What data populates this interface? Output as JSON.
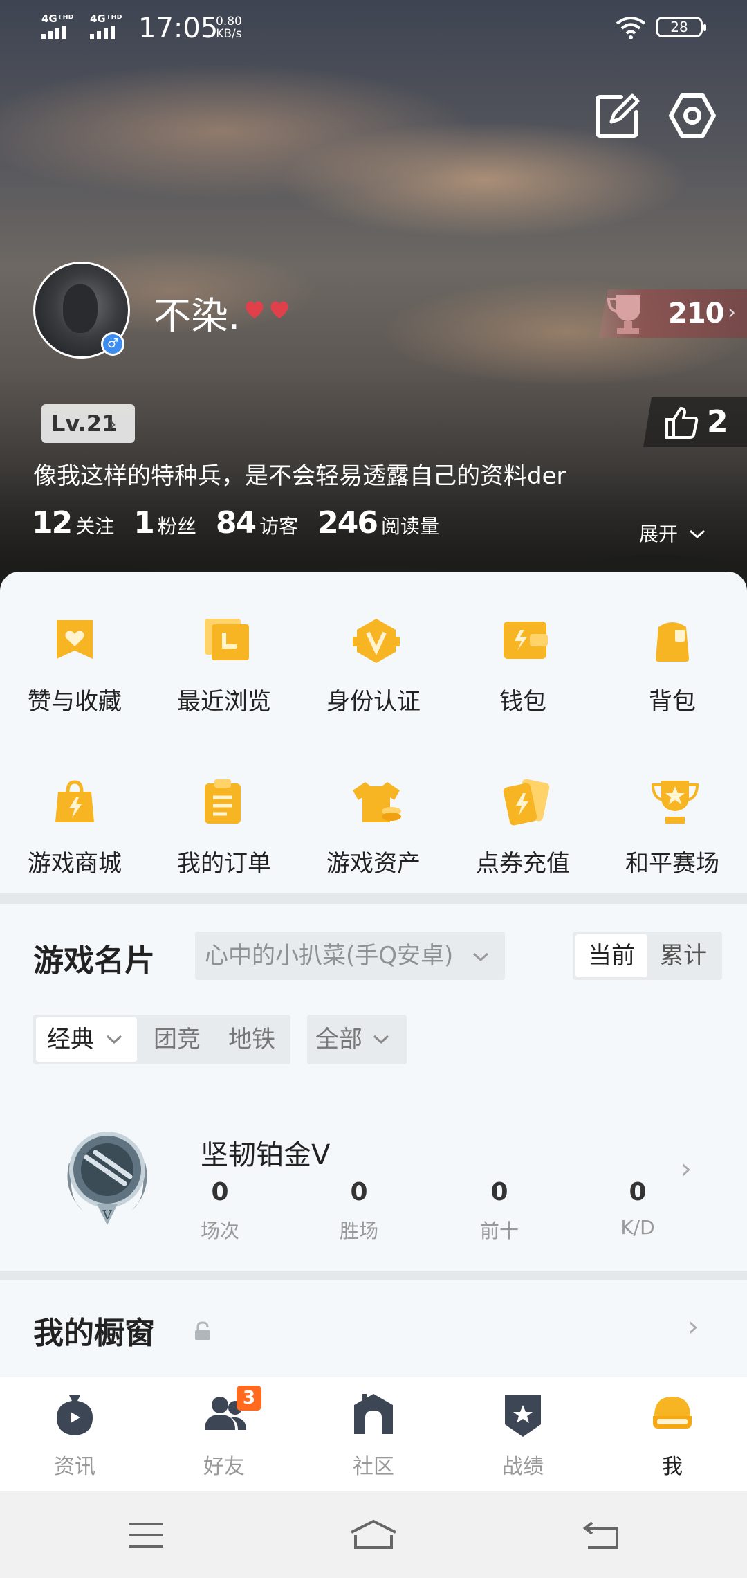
{
  "status_bar": {
    "signal1": "4G⁺ᴴᴰ",
    "signal2": "4G⁺ᴴᴰ",
    "time": "17:05",
    "speed_value": "0.80",
    "speed_unit": "KB/s",
    "battery": "28"
  },
  "profile": {
    "nickname": "不染.",
    "trophy_count": "210",
    "level": "Lv.21",
    "likes": "2",
    "bio": "像我这样的特种兵，是不会轻易透露自己的资料der",
    "stats": [
      {
        "value": "12",
        "label": "关注"
      },
      {
        "value": "1",
        "label": "粉丝"
      },
      {
        "value": "84",
        "label": "访客"
      },
      {
        "value": "246",
        "label": "阅读量"
      }
    ],
    "expand_label": "展开"
  },
  "menu": {
    "items": [
      {
        "label": "赞与收藏",
        "icon": "favorite-icon"
      },
      {
        "label": "最近浏览",
        "icon": "recent-icon"
      },
      {
        "label": "身份认证",
        "icon": "verify-icon"
      },
      {
        "label": "钱包",
        "icon": "wallet-icon"
      },
      {
        "label": "背包",
        "icon": "backpack-icon"
      },
      {
        "label": "游戏商城",
        "icon": "shop-icon"
      },
      {
        "label": "我的订单",
        "icon": "order-icon"
      },
      {
        "label": "游戏资产",
        "icon": "asset-icon"
      },
      {
        "label": "点券充值",
        "icon": "recharge-icon"
      },
      {
        "label": "和平赛场",
        "icon": "arena-icon"
      }
    ]
  },
  "game_card": {
    "title": "游戏名片",
    "account": "心中的小扒菜(手Q安卓)",
    "toggle": {
      "current": "当前",
      "total": "累计"
    },
    "modes": {
      "selected": "经典",
      "other1": "团竞",
      "other2": "地铁"
    },
    "filter": "全部",
    "rank_name": "坚韧铂金Ⅴ",
    "rank_stats": [
      {
        "value": "0",
        "label": "场次"
      },
      {
        "value": "0",
        "label": "胜场"
      },
      {
        "value": "0",
        "label": "前十"
      },
      {
        "value": "0",
        "label": "K/D"
      }
    ]
  },
  "showcase": {
    "title": "我的橱窗"
  },
  "tabs": [
    {
      "label": "资讯",
      "icon": "news-icon"
    },
    {
      "label": "好友",
      "icon": "friends-icon",
      "badge": "3"
    },
    {
      "label": "社区",
      "icon": "community-icon"
    },
    {
      "label": "战绩",
      "icon": "record-icon"
    },
    {
      "label": "我",
      "icon": "me-icon"
    }
  ],
  "colors": {
    "accent": "#f7b423",
    "badge": "#ff6a1e"
  }
}
